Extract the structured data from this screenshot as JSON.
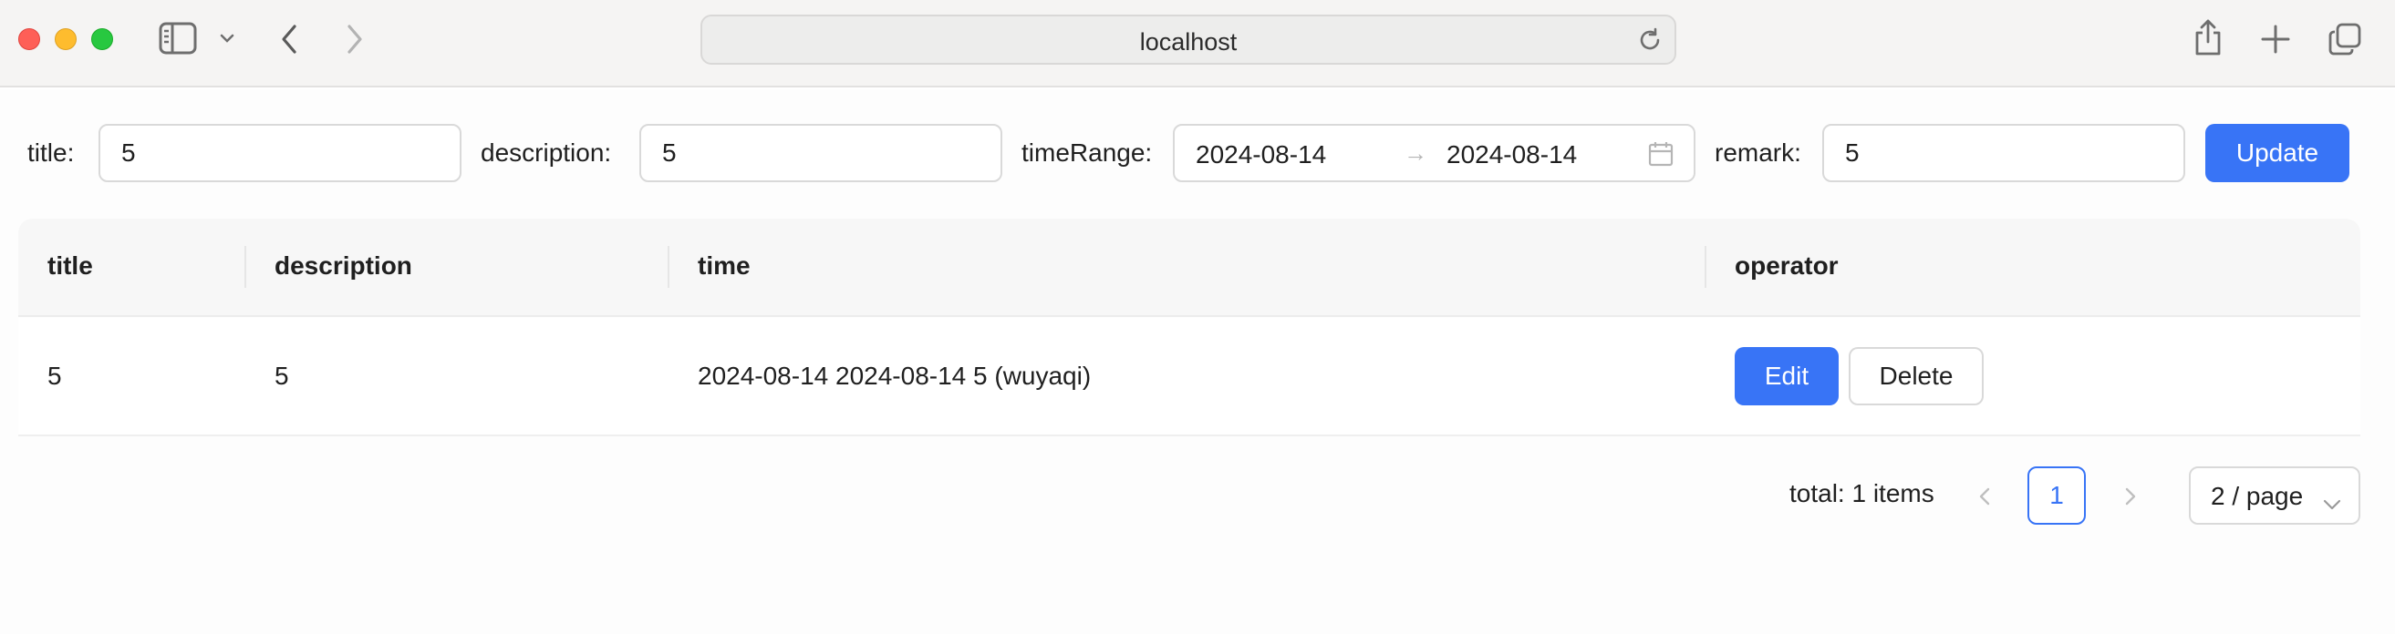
{
  "browser": {
    "url": "localhost"
  },
  "form": {
    "title_label": "title:",
    "title_value": "5",
    "description_label": "description:",
    "description_value": "5",
    "time_range_label": "timeRange:",
    "time_range_start": "2024-08-14",
    "time_range_separator": "→",
    "time_range_end": "2024-08-14",
    "remark_label": "remark:",
    "remark_value": "5",
    "update_label": "Update"
  },
  "table": {
    "columns": [
      "title",
      "description",
      "time",
      "operator"
    ],
    "rows": [
      {
        "title": "5",
        "description": "5",
        "time": "2024-08-14 2024-08-14 5 (wuyaqi)",
        "edit_label": "Edit",
        "delete_label": "Delete"
      }
    ]
  },
  "pagination": {
    "total_text": "total: 1 items",
    "current_page": "1",
    "page_size": "2 / page"
  },
  "colors": {
    "primary": "#3874f6",
    "border": "#d9d9d9",
    "header_bg": "#f7f7f7"
  },
  "icons": [
    "sidebar-icon",
    "chevron-down-icon",
    "back-icon",
    "forward-icon",
    "reload-icon",
    "share-icon",
    "new-tab-icon",
    "tabs-overview-icon",
    "calendar-icon",
    "prev-page-icon",
    "next-page-icon"
  ]
}
